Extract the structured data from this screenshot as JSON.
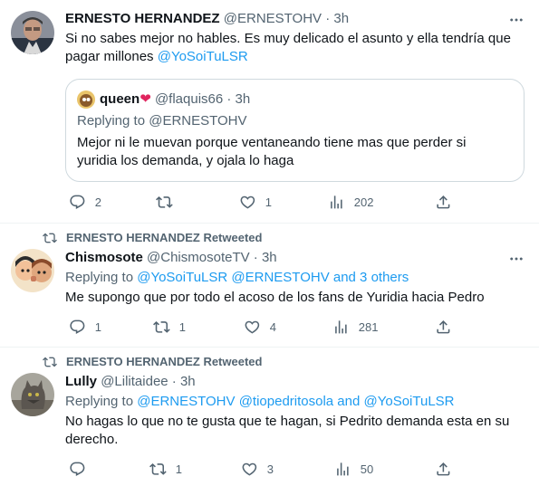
{
  "tweets": [
    {
      "name": "ERNESTO HERNANDEZ",
      "handle": "@ERNESTOHV",
      "time": "· 3h",
      "text_line1": "Si no sabes mejor no hables. Es muy delicado el asunto y ella tendría que",
      "text_line2": "pagar millones ",
      "mention": "@YoSoiTuLSR",
      "quote": {
        "name": "queen",
        "handle": "@flaquis66",
        "time": "· 3h",
        "replying_prefix": "Replying to ",
        "replying_to": "@ERNESTOHV",
        "text_line1": "Mejor ni le muevan porque ventaneando tiene mas que perder si",
        "text_line2": "yuridia los demanda, y ojala lo haga"
      },
      "stats": {
        "replies": "2",
        "retweets": "",
        "likes": "1",
        "views": "202"
      }
    },
    {
      "retweeted_by": "ERNESTO HERNANDEZ Retweeted",
      "name": "Chismosote",
      "handle": "@ChismosoteTV",
      "time": "· 3h",
      "replying_prefix": "Replying to ",
      "replying_to": "@YoSoiTuLSR @ERNESTOHV and 3 others",
      "text_line1": "Me supongo que por todo el acoso de los fans de Yuridia hacia Pedro",
      "stats": {
        "replies": "1",
        "retweets": "1",
        "likes": "4",
        "views": "281"
      }
    },
    {
      "retweeted_by": "ERNESTO HERNANDEZ Retweeted",
      "name": "Lully",
      "handle": "@Lilitaidee",
      "time": "· 3h",
      "replying_prefix": "Replying to ",
      "replying_to": "@ERNESTOHV @tiopedritosola and @YoSoiTuLSR",
      "text_line1": "No hagas lo que no te gusta que te hagan, si Pedrito demanda esta en su",
      "text_line2": "derecho.",
      "stats": {
        "replies": "",
        "retweets": "1",
        "likes": "3",
        "views": "50"
      }
    }
  ],
  "colors": {
    "link": "#1d9bf0",
    "muted": "#536471",
    "text": "#0f1419",
    "heart": "#e0245e"
  }
}
